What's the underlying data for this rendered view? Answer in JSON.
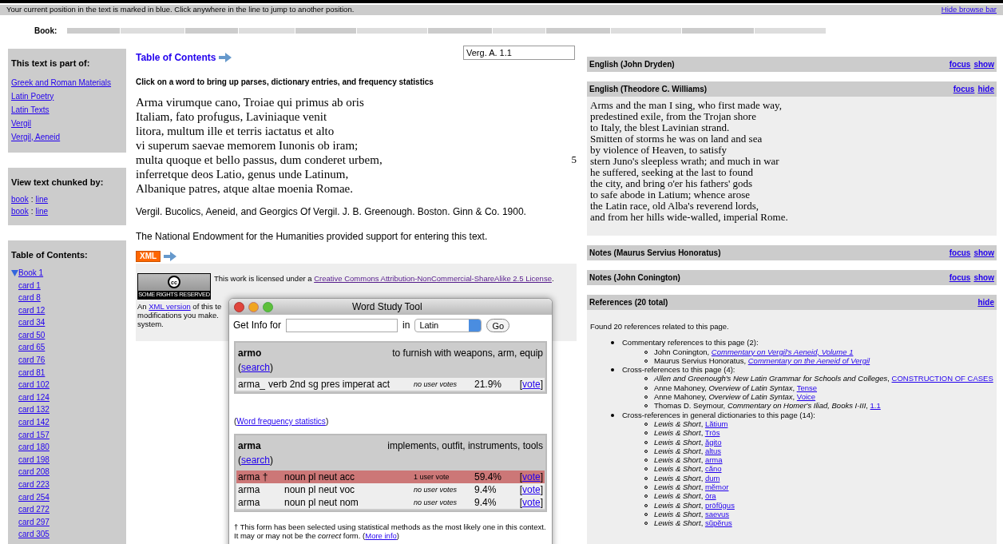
{
  "browse_bar": {
    "message": "Your current position in the text is marked in blue. Click anywhere in the line to jump to another position.",
    "hide_link": "Hide browse bar",
    "label": "Book:"
  },
  "sidebar": {
    "part_of": {
      "title": "This text is part of:",
      "links": [
        "Greek and Roman Materials",
        "Latin Poetry",
        "Latin Texts",
        "Vergil",
        "Vergil, Aeneid"
      ]
    },
    "chunked": {
      "title": "View text chunked by:",
      "rows": [
        [
          "book",
          ":",
          "line"
        ],
        [
          "book",
          ":",
          "line"
        ]
      ]
    },
    "toc": {
      "title": "Table of Contents:",
      "book": {
        "label": "Book 1",
        "expanded": true,
        "children": [
          "card 1",
          "card 8",
          "card 12",
          "card 34",
          "card 50",
          "card 65",
          "card 76",
          "card 81",
          "card 102",
          "card 124",
          "card 132",
          "card 142",
          "card 157",
          "card 180",
          "card 198",
          "card 208",
          "card 223",
          "card 254",
          "card 272",
          "card 297",
          "card 305"
        ]
      }
    }
  },
  "main": {
    "toc_link": "Table of Contents",
    "citation": "Verg. A. 1.1",
    "instruction": "Click on a word to bring up parses, dictionary entries, and frequency statistics",
    "lines": [
      {
        "text": "Arma virumque cano, Troiae qui primus ab oris"
      },
      {
        "text": "Italiam, fato profugus, Laviniaque venit"
      },
      {
        "text": "litora, multum ille et terris iactatus et alto"
      },
      {
        "text": "vi superum saevae memorem Iunonis ob iram;"
      },
      {
        "text": "multa quoque et bello passus, dum conderet urbem,",
        "number": "5"
      },
      {
        "text": "inferretque deos Latio, genus unde Latinum,"
      },
      {
        "text": "Albanique patres, atque altae moenia Romae."
      }
    ],
    "source": "Vergil. Bucolics, Aeneid, and Georgics Of Vergil. J. B. Greenough. Boston. Ginn & Co. 1900.",
    "support": "The National Endowment for the Humanities provided support for entering this text.",
    "xml_badge": "XML",
    "license": {
      "cc_symbol": "cc",
      "cc_caption": "SOME RIGHTS RESERVED",
      "before": "This work is licensed under a ",
      "link": "Creative Commons Attribution-NonCommercial-ShareAlike 2.5 License",
      "after": ".",
      "note_before": "An ",
      "note_link": "XML version",
      "note_after": " of this te",
      "note_lines": [
        "modifications you make.",
        "system."
      ]
    }
  },
  "word_tool": {
    "title": "Word Study Tool",
    "get_info_label": "Get Info for",
    "in_label": "in",
    "language": "Latin",
    "go": "Go",
    "entries": [
      {
        "lemma": "armo",
        "definition": "to furnish with weapons, arm, equip",
        "search": {
          "before": "(",
          "link": "search",
          "after": ")"
        },
        "parses": [
          {
            "form": "arma_",
            "analysis": "verb 2nd sg pres imperat act",
            "votes": "no user votes",
            "percent": "21.9%",
            "vote": {
              "before": "[",
              "link": "vote",
              "after": "]"
            },
            "selected": false
          }
        ]
      },
      {
        "lemma": "arma",
        "definition": "implements, outfit, instruments, tools",
        "search": {
          "before": "(",
          "link": "search",
          "after": ")"
        },
        "parses": [
          {
            "form": "arma †",
            "analysis": "noun pl neut acc",
            "votes": "1 user vote",
            "percent": "59.4%",
            "vote": {
              "before": "[",
              "link": "vote",
              "after": "]"
            },
            "selected": true
          },
          {
            "form": "arma",
            "analysis": "noun pl neut voc",
            "votes": "no user votes",
            "percent": "9.4%",
            "vote": {
              "before": "[",
              "link": "vote",
              "after": "]"
            },
            "selected": false
          },
          {
            "form": "arma",
            "analysis": "noun pl neut nom",
            "votes": "no user votes",
            "percent": "9.4%",
            "vote": {
              "before": "[",
              "link": "vote",
              "after": "]"
            },
            "selected": false
          }
        ]
      }
    ],
    "frequency_link": {
      "before": "(",
      "link": "Word frequency statistics",
      "after": ")"
    },
    "footnote": "† This form has been selected using statistical methods as the most likely one in this context. It may or may not be the *correct* form. (",
    "footnote_link": "More info",
    "footnote_after": ")"
  },
  "panels": [
    {
      "title": "English (John Dryden)",
      "focus": "focus",
      "toggle": "show"
    },
    {
      "title": "English (Theodore C. Williams)",
      "focus": "focus",
      "toggle": "hide",
      "kind": "translation",
      "lines": [
        "Arms and the man I sing, who first made way,",
        "predestined exile, from the Trojan shore",
        "to Italy, the blest Lavinian strand.",
        "Smitten of storms he was on land and sea",
        "by violence of Heaven, to satisfy",
        "stern Juno's sleepless wrath; and much in war",
        "he suffered, seeking at the last to found",
        "the city, and bring o'er his fathers' gods",
        "to safe abode in Latium; whence arose",
        "the Latin race, old Alba's reverend lords,",
        "and from her hills wide-walled, imperial Rome."
      ]
    },
    {
      "title": "Notes (Maurus Servius Honoratus)",
      "focus": "focus",
      "toggle": "show"
    },
    {
      "title": "Notes (John Conington)",
      "focus": "focus",
      "toggle": "show"
    },
    {
      "title": "References (20 total)",
      "toggle": "hide",
      "kind": "references",
      "intro": "Found 20 references related to this page.",
      "groups": [
        {
          "label": "Commentary references to this page (2):",
          "items": [
            {
              "text": "John Conington, ",
              "link": "Commentary on Vergil's Aeneid, Volume 1",
              "kind": "work"
            },
            {
              "text": "Maurus Servius Honoratus, ",
              "link": "Commentary on the Aeneid of Vergil",
              "kind": "work"
            }
          ]
        },
        {
          "label": "Cross-references to this page (4):",
          "items": [
            {
              "text": "*Allen and Greenough's New Latin Grammar for Schools and Colleges*, ",
              "link": "CONSTRUCTION OF CASES",
              "kind": "section"
            },
            {
              "text": "Anne Mahoney, *Overview of Latin Syntax*, ",
              "link": "Tense",
              "kind": "section"
            },
            {
              "text": "Anne Mahoney, *Overview of Latin Syntax*, ",
              "link": "Voice",
              "kind": "section"
            },
            {
              "text": "Thomas D. Seymour, *Commentary on Homer's Iliad, Books I-III*, ",
              "link": "1.1",
              "kind": "section"
            }
          ]
        },
        {
          "label": "Cross-references in general dictionaries to this page (14):",
          "items": [
            {
              "text": "*Lewis & Short*, ",
              "link": "Lătium",
              "kind": "section"
            },
            {
              "text": "*Lewis & Short*, ",
              "link": "Trōs",
              "kind": "section"
            },
            {
              "text": "*Lewis & Short*, ",
              "link": "ăgito",
              "kind": "section"
            },
            {
              "text": "*Lewis & Short*, ",
              "link": "altus",
              "kind": "section"
            },
            {
              "text": "*Lewis & Short*, ",
              "link": "arma",
              "kind": "section"
            },
            {
              "text": "*Lewis & Short*, ",
              "link": "căno",
              "kind": "section"
            },
            {
              "text": "*Lewis & Short*, ",
              "link": "dum",
              "kind": "section"
            },
            {
              "text": "*Lewis & Short*, ",
              "link": "mĕmor",
              "kind": "section"
            },
            {
              "text": "*Lewis & Short*, ",
              "link": "ōra",
              "kind": "section"
            },
            {
              "text": "*Lewis & Short*, ",
              "link": "prōfŭgus",
              "kind": "section"
            },
            {
              "text": "*Lewis & Short*, ",
              "link": "saevus",
              "kind": "section"
            },
            {
              "text": "*Lewis & Short*, ",
              "link": "sŭpĕrus",
              "kind": "section"
            }
          ]
        }
      ]
    }
  ]
}
